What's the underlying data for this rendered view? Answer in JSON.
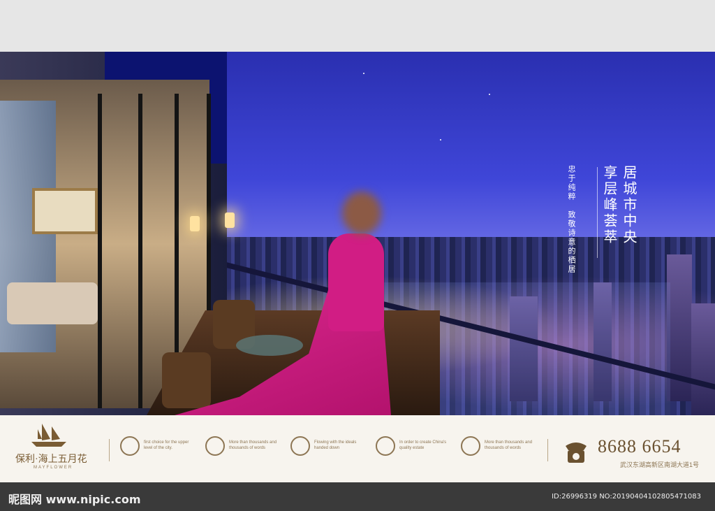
{
  "hero": {
    "headline_col1": "居城市中央",
    "headline_col2": "享层峰荟萃",
    "sub_col1": "忠于纯粹　致敬诗意的栖居"
  },
  "footer": {
    "logo_text": "保利·海上五月花",
    "logo_sub": "MAYFLOWER",
    "features": [
      {
        "icon": "circle-emblem-icon",
        "text": "first choice for the upper level of the city."
      },
      {
        "icon": "book-emblem-icon",
        "text": "More than thousands and thousands of words"
      },
      {
        "icon": "diamond-emblem-icon",
        "text": "Flowing with the ideals handed down"
      },
      {
        "icon": "wave-emblem-icon",
        "text": "In order to create China's quality estate"
      },
      {
        "icon": "flower-emblem-icon",
        "text": "More than thousands and thousands of words"
      }
    ],
    "phone": "8688 6654",
    "address": "武汉东湖高新区南湖大道1号"
  },
  "watermark": {
    "left": "昵图网 www.nipic.com",
    "right": "ID:26996319 NO:20190404102805471083"
  },
  "colors": {
    "sky": "#3f46d8",
    "dress": "#d11d84",
    "footer_bg": "#f7f4ee",
    "gold": "#8d7654"
  }
}
